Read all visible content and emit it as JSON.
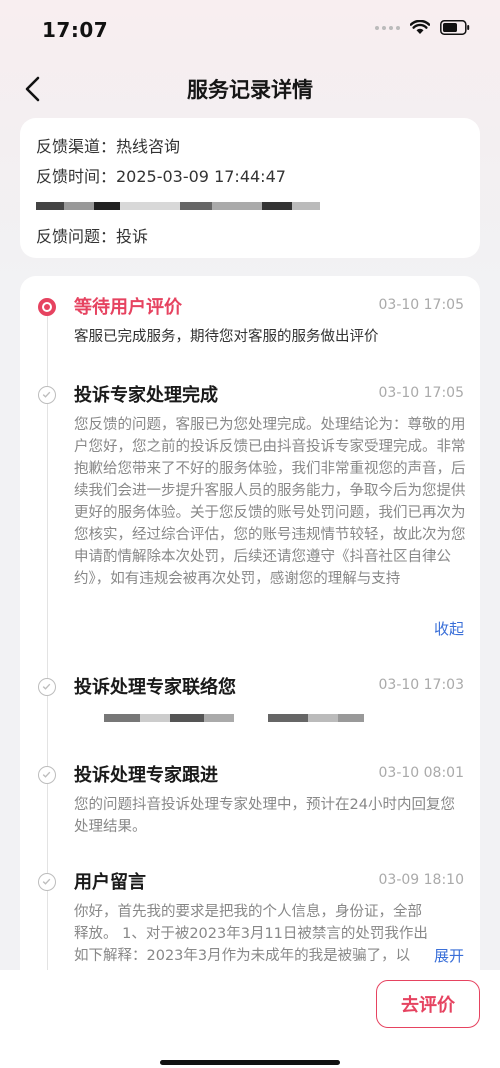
{
  "status_bar": {
    "time": "17:07"
  },
  "nav": {
    "title": "服务记录详情"
  },
  "info": {
    "channel": "反馈渠道：热线咨询",
    "time": "反馈时间：2025-03-09 17:44:47",
    "issue": "反馈问题：投诉"
  },
  "timeline": [
    {
      "title": "等待用户评价",
      "time": "03-10 17:05",
      "body": "客服已完成服务，期待您对客服的服务做出评价",
      "state": "active"
    },
    {
      "title": "投诉专家处理完成",
      "time": "03-10 17:05",
      "body": "您反馈的问题，客服已为您处理完成。处理结论为：尊敬的用户您好，您之前的投诉反馈已由抖音投诉专家受理完成。非常抱歉给您带来了不好的服务体验，我们非常重视您的声音，后续我们会进一步提升客服人员的服务能力，争取今后为您提供更好的服务体验。关于您反馈的账号处罚问题，我们已再次为您核实，经过综合评估，您的账号违规情节较轻，故此次为您申请酌情解除本次处罚，后续还请您遵守《抖音社区自律公约》，如有违规会被再次处罚，感谢您的理解与支持",
      "action": "收起",
      "state": "done"
    },
    {
      "title": "投诉处理专家联络您",
      "time": "03-10 17:03",
      "state": "done"
    },
    {
      "title": "投诉处理专家跟进",
      "time": "03-10 08:01",
      "body": "您的问题抖音投诉处理专家处理中，预计在24小时内回复您处理结果。",
      "state": "done"
    },
    {
      "title": "用户留言",
      "time": "03-09 18:10",
      "body": "你好，首先我的要求是把我的个人信息，身份证，全部释放。 1、对于被2023年3月11日被禁言的处罚我作出如下解释：2023年3月作为未成年的我是被骗了，以下...",
      "action": "展开",
      "state": "done"
    }
  ],
  "bottom": {
    "eval_button": "去评价"
  },
  "colors": {
    "accent": "#e64360",
    "link": "#3a6fd8"
  }
}
